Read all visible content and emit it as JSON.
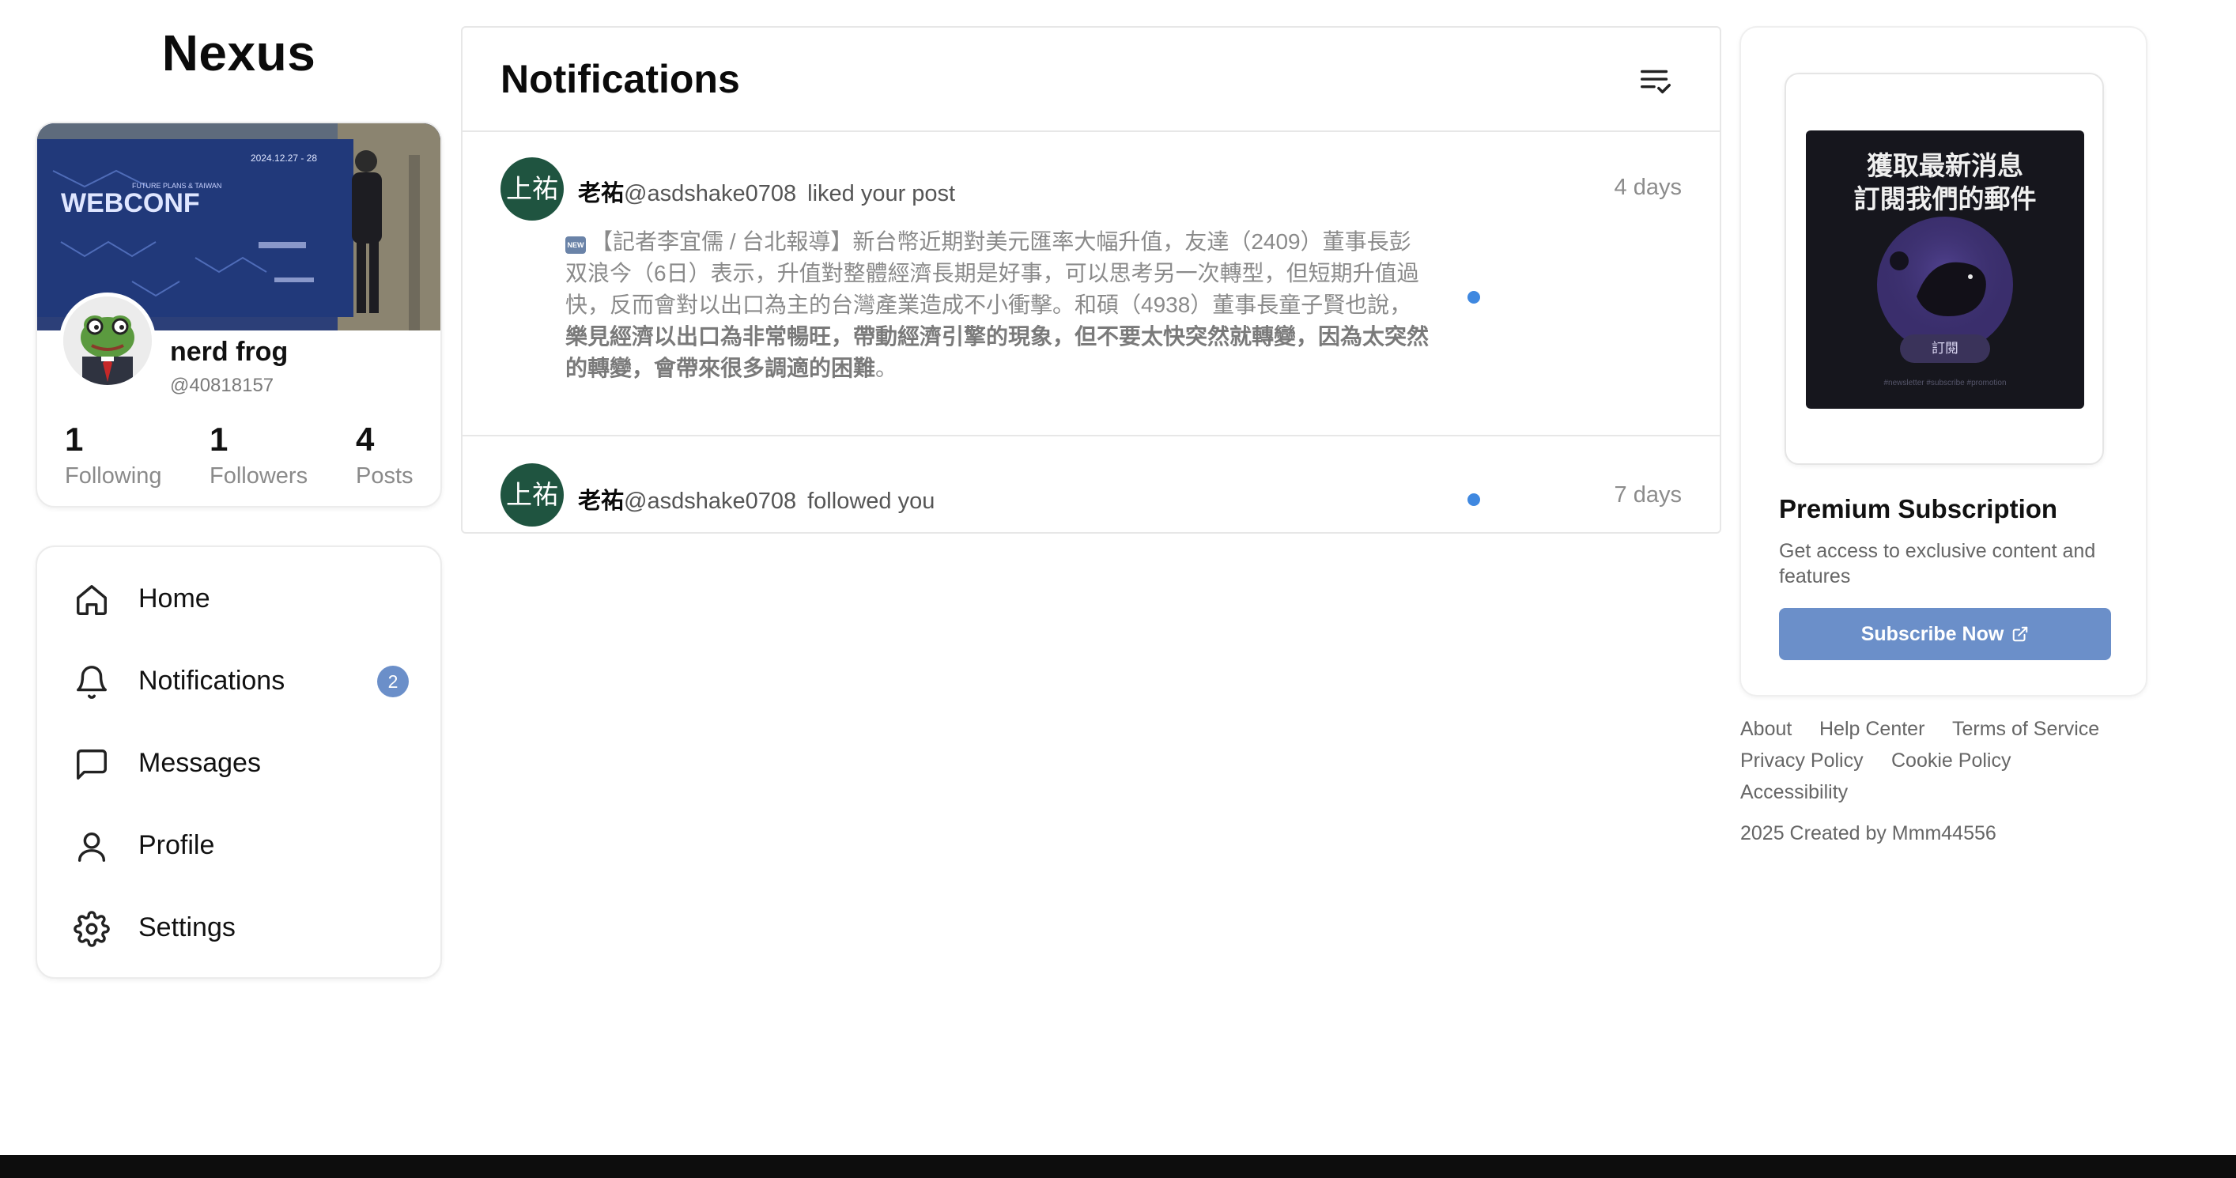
{
  "app": {
    "logo": "Nexus"
  },
  "profile": {
    "name": "nerd frog",
    "handle": "@40818157",
    "banner_text": "WEBCONF",
    "banner_subtext": "FUTURE PLANS & TAIWAN",
    "stats": [
      {
        "value": "1",
        "label": "Following"
      },
      {
        "value": "1",
        "label": "Followers"
      },
      {
        "value": "4",
        "label": "Posts"
      }
    ]
  },
  "nav": {
    "items": [
      {
        "label": "Home",
        "icon": "home-icon"
      },
      {
        "label": "Notifications",
        "icon": "bell-icon",
        "badge": "2"
      },
      {
        "label": "Messages",
        "icon": "message-icon"
      },
      {
        "label": "Profile",
        "icon": "user-icon"
      },
      {
        "label": "Settings",
        "icon": "gear-icon"
      }
    ]
  },
  "notifications": {
    "title": "Notifications",
    "items": [
      {
        "avatar_text": "上祐",
        "name": "老祐",
        "handle": "@asdshake0708",
        "action": "liked your post",
        "time": "4 days",
        "unread": true,
        "body_plain": "【記者李宜儒 / 台北報導】新台幣近期對美元匯率大幅升值，友達（2409）董事長彭双浪今（6日）表示，升值對整體經濟長期是好事，可以思考另一次轉型，但短期升值過快，反而會對以出口為主的台灣產業造成不小衝擊。和碩（4938）董事長童子賢也說，",
        "body_bold": "樂見經濟以出口為非常暢旺，帶動經濟引擎的現象，但不要太快突然就轉變，因為太突然的轉變，會帶來很多調適的困難",
        "body_end": "。",
        "new_tag": "NEW"
      },
      {
        "avatar_text": "上祐",
        "name": "老祐",
        "handle": "@asdshake0708",
        "action": "followed you",
        "time": "7 days",
        "unread": true
      }
    ]
  },
  "ad": {
    "line1": "獲取最新消息",
    "line2": "訂閱我們的郵件",
    "button": "訂閱",
    "tags": "#newsletter  #subscribe  #promotion"
  },
  "premium": {
    "title": "Premium Subscription",
    "description": "Get access to exclusive content and features",
    "button": "Subscribe Now"
  },
  "footer": {
    "links": [
      "About",
      "Help Center",
      "Terms of Service",
      "Privacy Policy",
      "Cookie Policy",
      "Accessibility"
    ],
    "copyright": "2025 Created by Mmm44556"
  },
  "colors": {
    "accent": "#6b8fc9",
    "unread_dot": "#3f88e0",
    "avatar_bg": "#1f5440"
  }
}
